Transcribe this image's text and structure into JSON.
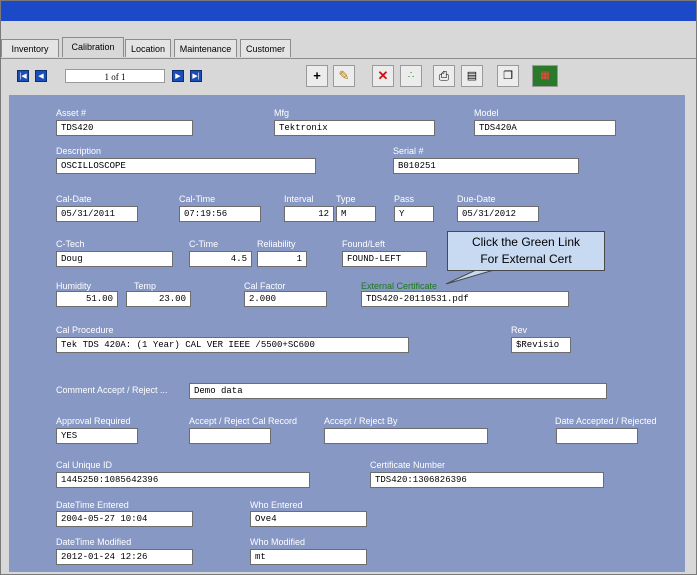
{
  "tabs": [
    {
      "label": "Inventory",
      "active": false
    },
    {
      "label": "Calibration",
      "active": true
    },
    {
      "label": "Location",
      "active": false
    },
    {
      "label": "Maintenance",
      "active": false
    },
    {
      "label": "Customer",
      "active": false
    }
  ],
  "nav": {
    "page_text": "1 of 1"
  },
  "toolbar_icons": [
    "add-icon",
    "edit-icon",
    "delete-icon",
    "green-dots-icon",
    "print-icon",
    "grid-icon",
    "copy-icon",
    "calculator-icon"
  ],
  "form": {
    "asset_label": "Asset #",
    "asset_value": "TDS420",
    "mfg_label": "Mfg",
    "mfg_value": "Tektronix",
    "model_label": "Model",
    "model_value": "TDS420A",
    "description_label": "Description",
    "description_value": "OSCILLOSCOPE",
    "serial_label": "Serial #",
    "serial_value": "B010251",
    "cal_date_label": "Cal-Date",
    "cal_date_value": "05/31/2011",
    "cal_time_label": "Cal-Time",
    "cal_time_value": "07:19:56",
    "interval_label": "Interval",
    "interval_value": "12",
    "type_label": "Type",
    "type_value": "M",
    "pass_label": "Pass",
    "pass_value": "Y",
    "due_date_label": "Due-Date",
    "due_date_value": "05/31/2012",
    "ctech_label": "C-Tech",
    "ctech_value": "Doug",
    "ctime_label": "C-Time",
    "ctime_value": "4.5",
    "reliability_label": "Reliability",
    "reliability_value": "1",
    "found_left_label": "Found/Left",
    "found_left_value": "FOUND-LEFT",
    "humidity_label": "Humidity",
    "humidity_value": "51.00",
    "temp_label": "Temp",
    "temp_value": "23.00",
    "cal_factor_label": "Cal Factor",
    "cal_factor_value": "2.000",
    "ext_cert_label": "External Certificate",
    "ext_cert_value": "TDS420-20110531.pdf",
    "cal_procedure_label": "Cal Procedure",
    "cal_procedure_value": "Tek TDS 420A: (1 Year) CAL VER IEEE /5500+SC600",
    "rev_label": "Rev",
    "rev_value": "$Revisio",
    "comment_label": "Comment Accept / Reject ...",
    "comment_value": "Demo data",
    "approval_label": "Approval Required",
    "approval_value": "YES",
    "accept_record_label": "Accept / Reject Cal Record",
    "accept_record_value": "",
    "accept_by_label": "Accept / Reject By",
    "accept_by_value": "",
    "date_accepted_label": "Date Accepted / Rejected",
    "date_accepted_value": "",
    "cal_unique_label": "Cal Unique ID",
    "cal_unique_value": "1445250:1085642396",
    "cert_number_label": "Certificate Number",
    "cert_number_value": "TDS420:1306826396",
    "dt_entered_label": "DateTime Entered",
    "dt_entered_value": "2004-05-27 10:04",
    "who_entered_label": "Who Entered",
    "who_entered_value": "Ove4",
    "dt_modified_label": "DateTime Modified",
    "dt_modified_value": "2012-01-24 12:26",
    "who_modified_label": "Who Modified",
    "who_modified_value": "mt"
  },
  "callout": {
    "line1": "Click the Green Link",
    "line2": "For External Cert"
  },
  "colors": {
    "title_bar": "#1b49c7",
    "panel": "#8898c4",
    "link_green": "#1a7a1a",
    "callout": "#c8d9f2"
  }
}
